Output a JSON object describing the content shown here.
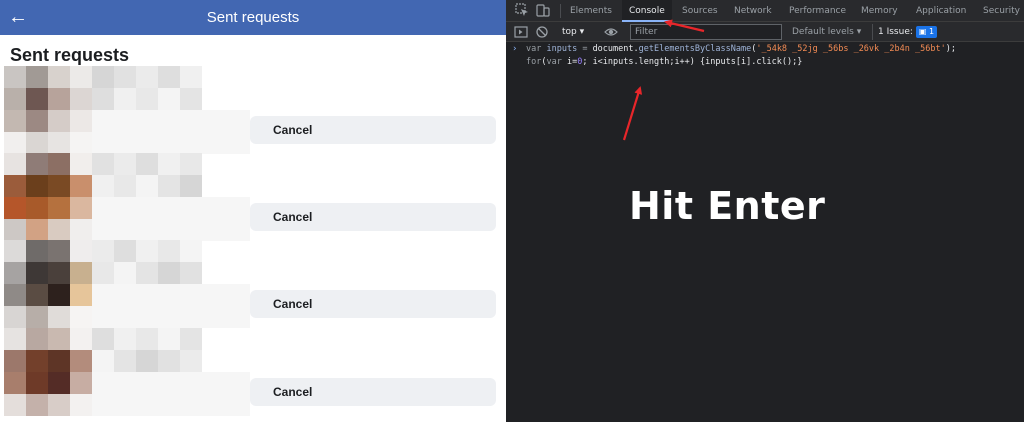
{
  "fb": {
    "header_title": "Sent requests",
    "back_icon": "back-arrow-icon",
    "page_title": "Sent requests",
    "request_buttons": [
      {
        "label": "Cancel"
      },
      {
        "label": "Cancel"
      },
      {
        "label": "Cancel"
      },
      {
        "label": "Cancel"
      }
    ]
  },
  "devtools": {
    "tabs": [
      "Elements",
      "Console",
      "Sources",
      "Network",
      "Performance",
      "Memory",
      "Application",
      "Security"
    ],
    "active_tab": "Console",
    "toolbar": {
      "context": "top",
      "filter_placeholder": "Filter",
      "levels": "Default levels",
      "issues_label": "1 Issue:",
      "issues_count": "1"
    },
    "console": {
      "line1": {
        "kw": "var",
        "id": "inputs",
        "eq": " = ",
        "obj": "document.",
        "fn": "getElementsByClassName",
        "open": "(",
        "str": "'_54k8 _52jg _56bs _26vk _2b4n _56bt'",
        "close": ");"
      },
      "line2": {
        "kw": "for",
        "open": "(",
        "kw2": "var",
        "rest1": " i=",
        "num": "0",
        "rest2": "; i<inputs.length;i++) {inputs[i].click();}"
      }
    }
  },
  "annotation": {
    "text": "Hit Enter",
    "arrow_color": "#e8262a"
  },
  "colors": {
    "fb_blue": "#4267b2",
    "devtools_bg": "#202124",
    "devtools_bar": "#292a2d"
  }
}
